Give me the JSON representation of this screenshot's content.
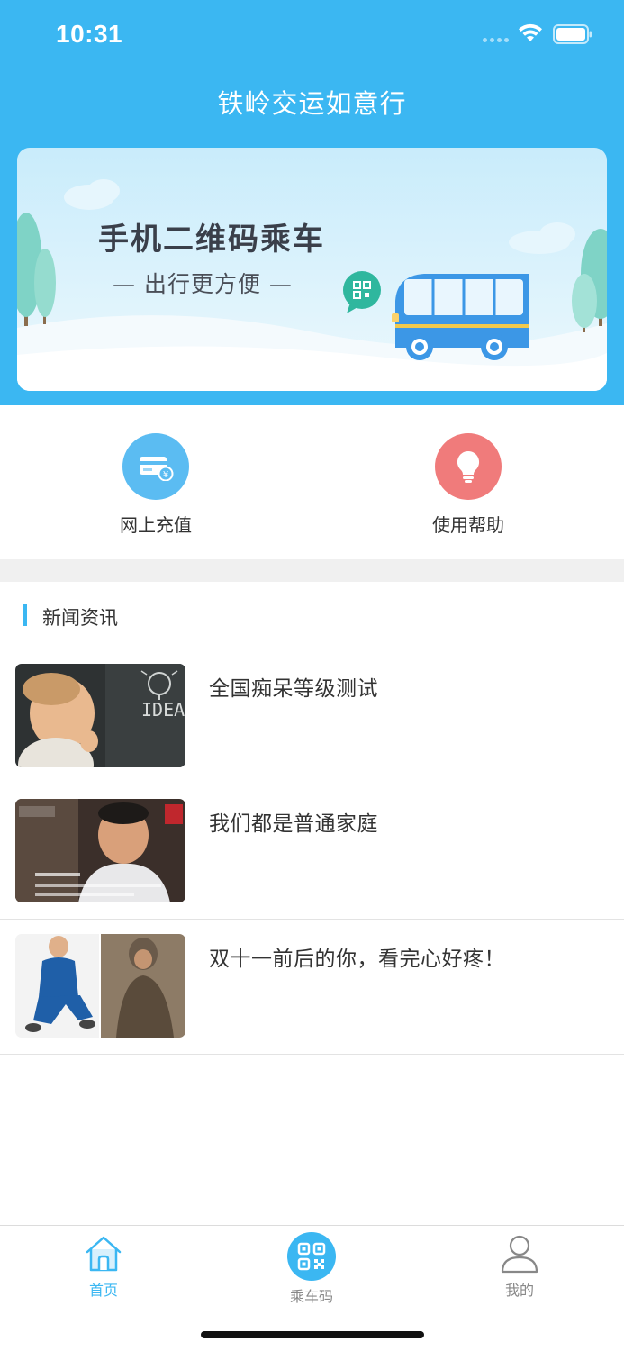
{
  "status_bar": {
    "time": "10:31"
  },
  "app": {
    "title": "铁岭交运如意行"
  },
  "banner": {
    "headline": "手机二维码乘车",
    "subtitle": "— 出行更方便 —"
  },
  "actions": [
    {
      "label": "网上充值",
      "icon": "card-icon",
      "color": "#5bbcf2"
    },
    {
      "label": "使用帮助",
      "icon": "lightbulb-icon",
      "color": "#f07b7b"
    }
  ],
  "news": {
    "section_title": "新闻资讯",
    "items": [
      {
        "title": "全国痴呆等级测试"
      },
      {
        "title": "我们都是普通家庭"
      },
      {
        "title": "双十一前后的你，看完心好疼！"
      }
    ]
  },
  "tabbar": {
    "items": [
      {
        "label": "首页",
        "icon": "home-icon",
        "active": true
      },
      {
        "label": "乘车码",
        "icon": "qr-code-icon",
        "active": false
      },
      {
        "label": "我的",
        "icon": "user-icon",
        "active": false
      }
    ]
  },
  "colors": {
    "primary": "#3bb7f2",
    "help": "#f07b7b",
    "inactive": "#888888"
  }
}
